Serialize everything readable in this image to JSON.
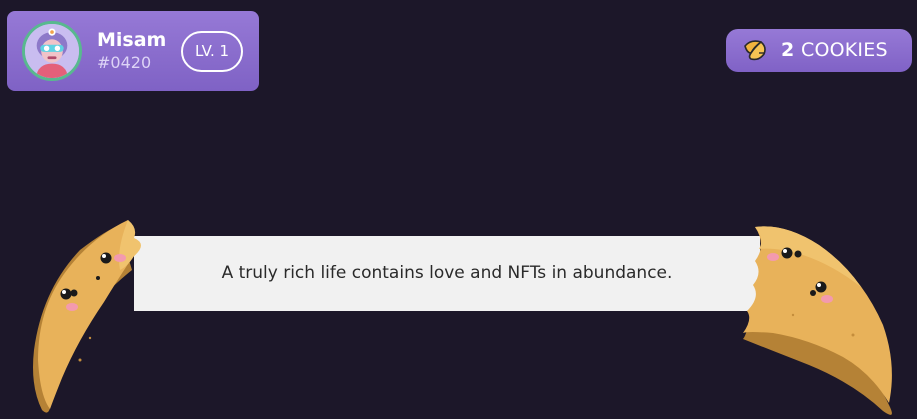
{
  "profile": {
    "name": "Misam",
    "tag": "#0420",
    "level": "LV. 1",
    "avatar_icon": "avatar-icon"
  },
  "cookies": {
    "count": "2",
    "unit": "COOKIES",
    "icon": "cookie-icon"
  },
  "fortune": {
    "message": "A truly rich life contains love and NFTs in abundance."
  },
  "colors": {
    "background": "#1c1729",
    "accent": "#8b6fd0",
    "strip": "#f1f1f1",
    "cookie": "#e8b25a",
    "avatar_ring": "#58b98f"
  }
}
